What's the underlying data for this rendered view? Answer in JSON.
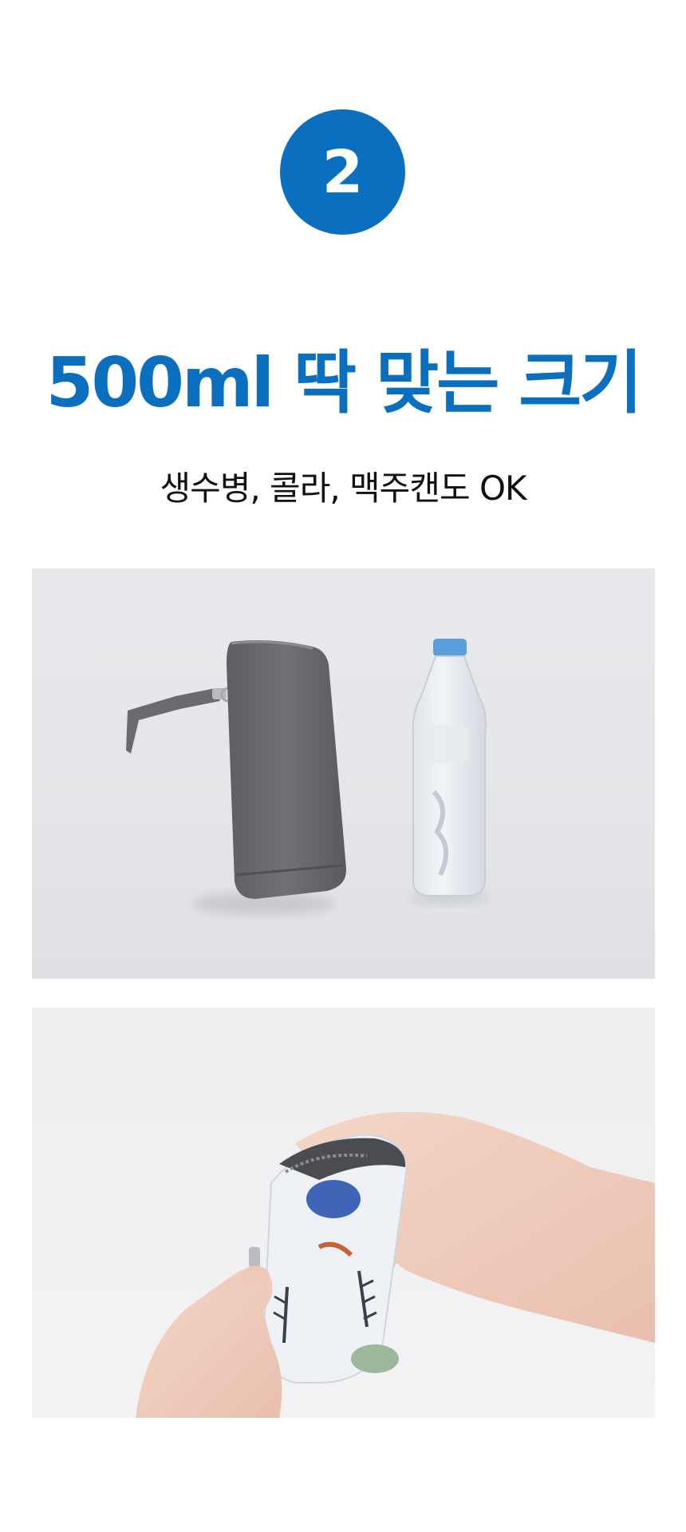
{
  "step": {
    "number": "2"
  },
  "headline": {
    "text": "500ml 딱 맞는 크기"
  },
  "subline": {
    "text": "생수병, 콜라, 맥주캔도 OK"
  },
  "colors": {
    "accent": "#0b6fc0",
    "text": "#111111",
    "background": "#ffffff"
  },
  "photos": [
    {
      "id": "photo-size-comparison"
    },
    {
      "id": "photo-insert-bottle"
    }
  ]
}
